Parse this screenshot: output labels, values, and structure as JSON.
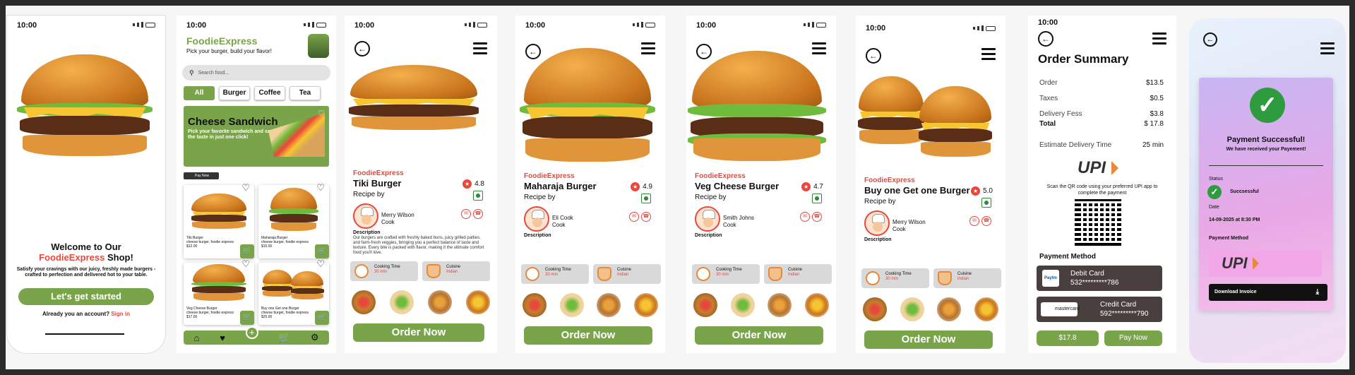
{
  "screens": {
    "welcome": {
      "time": "10:00",
      "welcome_prefix": "Welcome to Our",
      "brand": "FoodieExpress",
      "welcome_suffix": " Shop!",
      "tagline": "Satisfy your cravings with our juicy, freshly made burgers - crafted to perfection and delivered hot to your table.",
      "cta": "Let's get started",
      "account_q": "Already you an account?",
      "signin": "Sign in"
    },
    "home": {
      "time": "10:00",
      "brand": "FoodieExpress",
      "tagline": "Pick your burger, build your flavor!",
      "search_placeholder": "Search food...",
      "categories": [
        "All",
        "Burger",
        "Coffee",
        "Tea"
      ],
      "banner_title": "Cheese Sandwich",
      "banner_sub": "Pick your favorite sandwich and savor the taste in just one click!",
      "pay_now": "Pay Now",
      "products": [
        {
          "name": "Tiki Burger",
          "desc": "cheese burger, foodie express",
          "price": "$12.00"
        },
        {
          "name": "Maharaja Burger",
          "desc": "cheese burger, foodie express",
          "price": "$15.00"
        },
        {
          "name": "Veg Cheese Burger",
          "desc": "cheese burger, foodie express",
          "price": "$17.00"
        },
        {
          "name": "Buy one Get one Burger",
          "desc": "cheese burger, foodie express",
          "price": "$25.00"
        }
      ]
    },
    "details": [
      {
        "time": "10:00",
        "brand": "FoodieExpress",
        "name": "Tiki Burger",
        "rating": "4.8",
        "recipe_by": "Recipe by",
        "chef": "Merry Wilson",
        "role": "Cook",
        "desc_label": "Description",
        "desc": "Our burgers are crafted with freshly baked buns, juicy grilled patties, and farm-fresh veggies, bringing you a perfect balance of taste and texture. Every bite is packed with flavor, making it the ultimate comfort food you'll love.",
        "cook_label": "Cooking Time",
        "cook_val": "30 min",
        "cuisine_label": "Cuisine",
        "cuisine_val": "Indian",
        "order": "Order Now"
      },
      {
        "time": "10:00",
        "brand": "FoodieExpress",
        "name": "Maharaja Burger",
        "rating": "4.9",
        "recipe_by": "Recipe by",
        "chef": "Eli Cook",
        "role": "Cook",
        "desc_label": "Description",
        "desc": "",
        "cook_label": "Cooking Time",
        "cook_val": "30 min",
        "cuisine_label": "Cuisine",
        "cuisine_val": "Indian",
        "order": "Order Now"
      },
      {
        "time": "10:00",
        "brand": "FoodieExpress",
        "name": "Veg Cheese Burger",
        "rating": "4.7",
        "recipe_by": "Recipe by",
        "chef": "Smith Johns",
        "role": "Cook",
        "desc_label": "Description",
        "desc": "",
        "cook_label": "Cooking Time",
        "cook_val": "30 min",
        "cuisine_label": "Cuisine",
        "cuisine_val": "Indian",
        "order": "Order Now"
      },
      {
        "time": "10:00",
        "brand": "FoodieExpress",
        "name": "Buy one Get one Burger",
        "rating": "5.0",
        "recipe_by": "Recipe by",
        "chef": "Merry Wilson",
        "role": "Cook",
        "desc_label": "Description",
        "desc": "",
        "cook_label": "Cooking Time",
        "cook_val": "30 min",
        "cuisine_label": "Cuisine",
        "cuisine_val": "Indian",
        "order": "Order Now"
      }
    ],
    "summary": {
      "time": "10:00",
      "title": "Order Summary",
      "rows": [
        {
          "label": "Order",
          "value": "$13.5"
        },
        {
          "label": "Taxes",
          "value": "$0.5"
        },
        {
          "label": "Delivery Fess",
          "value": "$3.8"
        },
        {
          "label": "Total",
          "value": "$ 17.8"
        }
      ],
      "eta_label": "Estimate Delivery Time",
      "eta_value": "25 min",
      "upi": "UPI",
      "scan_text": "Scan the QR  code using your preferred UPI app  to complete the payment",
      "pm_label": "Payment Method",
      "cards": [
        {
          "type": "Debit Card",
          "number": "532*********786",
          "badge": "Paytm"
        },
        {
          "type": "Credit Card",
          "number": "592*********790",
          "badge": "mastercard"
        }
      ],
      "amount_btn": "$17.8",
      "pay_btn": "Pay Now"
    },
    "success": {
      "title": "Payment Successful!",
      "sub": "We have received your Payement!",
      "status_label": "Status",
      "status_value": "Succsessful",
      "date_label": "Date",
      "date_value": "14-09-2025 at 8:30 PM",
      "pm_label": "Payment Method",
      "upi": "UPI",
      "download": "Download Invoice"
    }
  },
  "colors": {
    "accent_green": "#7aa44a",
    "accent_red": "#e8473b"
  }
}
